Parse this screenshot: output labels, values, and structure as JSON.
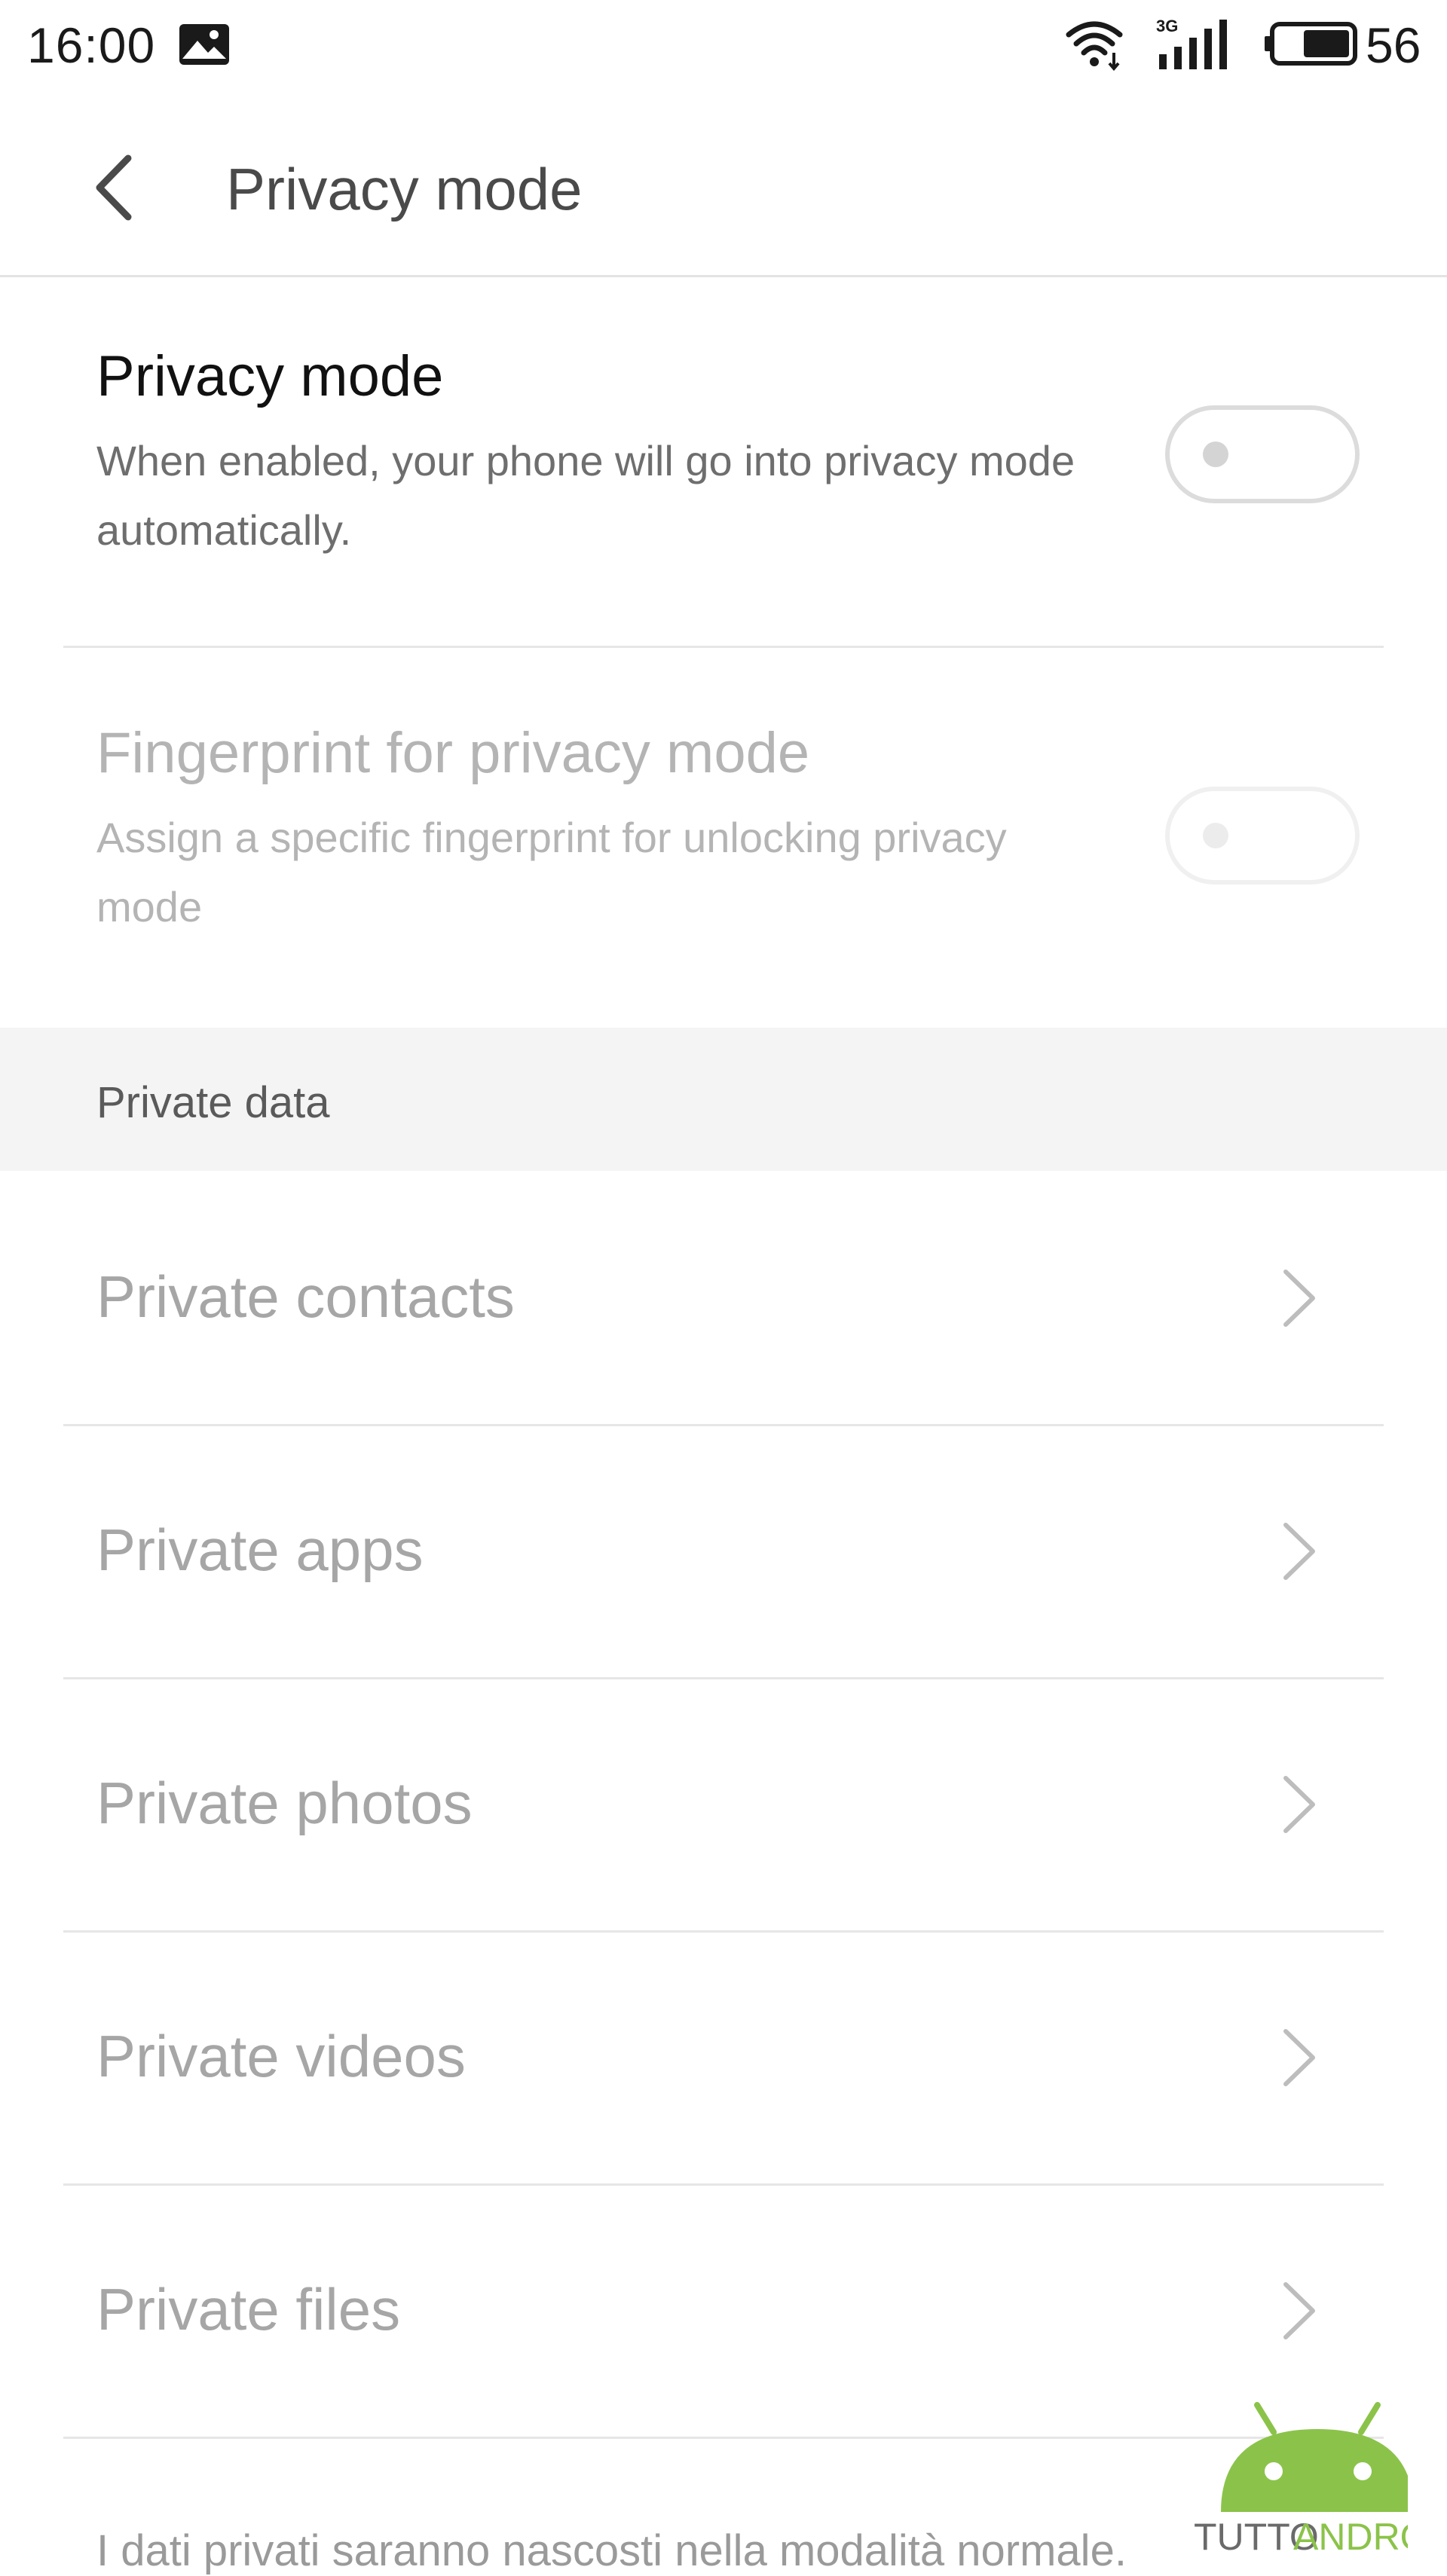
{
  "status_bar": {
    "time": "16:00",
    "network_type": "3G",
    "battery": "56",
    "icons": [
      "image-icon",
      "wifi-icon",
      "signal-icon",
      "battery-icon"
    ]
  },
  "header": {
    "back_icon": "back-arrow-icon",
    "title": "Privacy mode"
  },
  "privacy_toggle": {
    "title": "Privacy mode",
    "description": "When enabled, your phone will go into privacy mode automatically.",
    "enabled": false
  },
  "fingerprint_toggle": {
    "title": "Fingerprint for privacy mode",
    "description": "Assign a specific fingerprint for unlocking privacy mode",
    "enabled": false,
    "disabled": true
  },
  "private_data": {
    "section_title": "Private data",
    "items": [
      {
        "label": "Private contacts"
      },
      {
        "label": "Private apps"
      },
      {
        "label": "Private photos"
      },
      {
        "label": "Private videos"
      },
      {
        "label": "Private files"
      }
    ]
  },
  "footer_note": "I dati privati saranno nascosti nella modalità normale.",
  "watermark": {
    "text_dark": "TUTTO",
    "text_accent": "ANDROID"
  },
  "colors": {
    "primary_text": "#111111",
    "secondary_text": "#6e6e6e",
    "disabled_text": "#b4b4b4",
    "nav_text": "#a6a6a6",
    "section_bg": "#f4f4f4",
    "divider": "#e6e6e6",
    "watermark_green": "#8bc34a"
  }
}
